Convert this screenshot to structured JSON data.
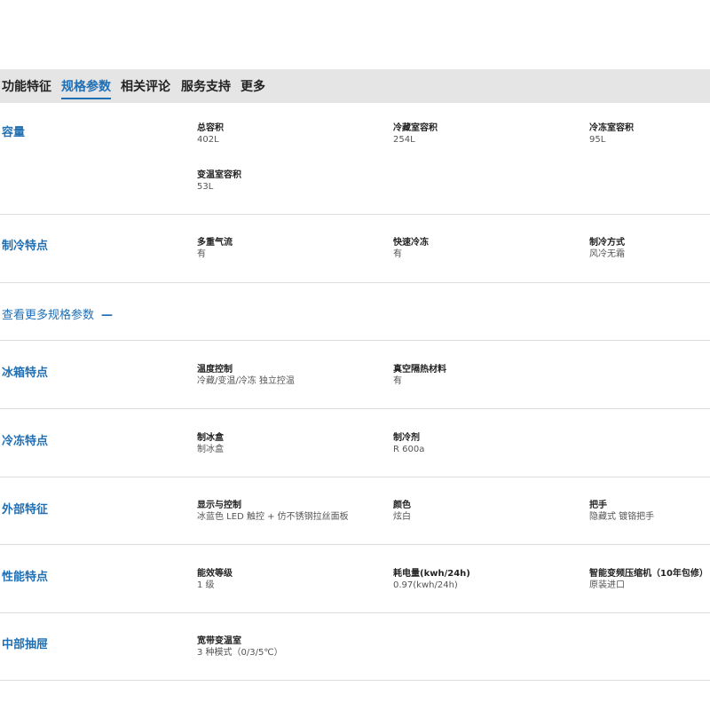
{
  "tabs": [
    {
      "label": "功能特征"
    },
    {
      "label": "规格参数"
    },
    {
      "label": "相关评论"
    },
    {
      "label": "服务支持"
    },
    {
      "label": "更多"
    }
  ],
  "active_tab": "规格参数",
  "capacity": {
    "category": "容量",
    "items": [
      {
        "name": "总容积",
        "value": "402L"
      },
      {
        "name": "冷藏室容积",
        "value": "254L"
      },
      {
        "name": "冷冻室容积",
        "value": "95L"
      },
      {
        "name": "变温室容积",
        "value": "53L"
      }
    ]
  },
  "cooling": {
    "category": "制冷特点",
    "items": [
      {
        "name": "多重气流",
        "value": "有"
      },
      {
        "name": "快速冷冻",
        "value": "有"
      },
      {
        "name": "制冷方式",
        "value": "风冷无霜"
      }
    ]
  },
  "view_more": {
    "label": "查看更多规格参数",
    "icon": "—"
  },
  "fridge": {
    "category": "冰箱特点",
    "items": [
      {
        "name": "温度控制",
        "value": "冷藏/变温/冷冻 独立控温"
      },
      {
        "name": "真空隔热材料",
        "value": "有"
      }
    ]
  },
  "freezer": {
    "category": "冷冻特点",
    "items": [
      {
        "name": "制冰盒",
        "value": "制冰盒"
      },
      {
        "name": "制冷剂",
        "value": "R 600a"
      }
    ]
  },
  "exterior": {
    "category": "外部特征",
    "items": [
      {
        "name": "显示与控制",
        "value": "冰蓝色 LED 触控 + 仿不锈钢拉丝面板"
      },
      {
        "name": "颜色",
        "value": "炫白"
      },
      {
        "name": "把手",
        "value": "隐藏式 镀铬把手"
      }
    ]
  },
  "performance": {
    "category": "性能特点",
    "items": [
      {
        "name": "能效等级",
        "value": "1 级"
      },
      {
        "name": "耗电量(kwh/24h)",
        "value": "0.97(kwh/24h)"
      },
      {
        "name": "智能变频压缩机（10年包修）",
        "value": "原装进口"
      }
    ]
  },
  "drawer": {
    "category": "中部抽屉",
    "items": [
      {
        "name": "宽带变温室",
        "value": "3 种模式（0/3/5℃）"
      }
    ]
  },
  "colors": {
    "accent": "#1f6fb5",
    "tabbar_bg": "#e5e5e5",
    "divider": "#dcdcdc"
  }
}
